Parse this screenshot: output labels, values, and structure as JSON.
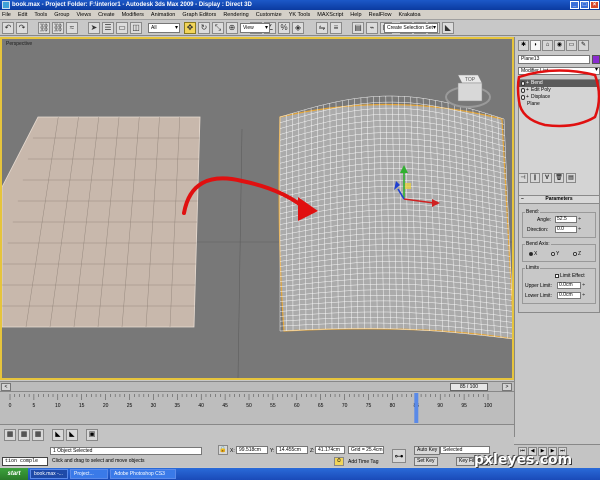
{
  "window": {
    "title": "book.max   - Project Folder: F:\\interior1   - Autodesk 3ds Max  2009   - Display : Direct 3D"
  },
  "menu": [
    "File",
    "Edit",
    "Tools",
    "Group",
    "Views",
    "Create",
    "Modifiers",
    "Animation",
    "Graph Editors",
    "Rendering",
    "Customize",
    "YK Tools",
    "MAXScript",
    "Help",
    "RealFlow",
    "Krakatoa"
  ],
  "toolbar": {
    "filter_value": "All",
    "refcoord_value": "View",
    "selection_set_placeholder": "Create Selection Set",
    "icons": [
      "undo-icon",
      "redo-icon",
      "link-icon",
      "unlink-icon",
      "bind-icon",
      "select-icon",
      "select-by-name-icon",
      "rect-select-icon",
      "window-crossing-icon",
      "move-icon",
      "rotate-icon",
      "scale-icon",
      "pivot-icon",
      "snap-icon",
      "angle-snap-icon",
      "percent-snap-icon",
      "spinner-snap-icon",
      "mirror-icon",
      "align-icon",
      "layers-icon",
      "curve-editor-icon",
      "schematic-icon",
      "material-editor-icon",
      "render-setup-icon",
      "render-icon",
      "quick-render-icon"
    ]
  },
  "viewport": {
    "label": "Perspective",
    "viewcube_label": "TOP",
    "border_color": "#e6c43c"
  },
  "command_panel": {
    "object_name": "Plane13",
    "object_color": "#8a2bd0",
    "modifier_list_label": "Modifier List",
    "stack": [
      {
        "name": "Bend",
        "selected": true
      },
      {
        "name": "Edit Poly",
        "selected": false
      },
      {
        "name": "Displace",
        "selected": false
      },
      {
        "name": "Plane",
        "selected": false
      }
    ],
    "parameters": {
      "rollout_title": "Parameters",
      "bend_group": "Bend:",
      "angle_label": "Angle:",
      "angle_value": "52.5",
      "direction_label": "Direction:",
      "direction_value": "0.0",
      "axis_group": "Bend Axis:",
      "axis_options": [
        "X",
        "Y",
        "Z"
      ],
      "axis_selected": "X",
      "limits_group": "Limits",
      "limit_effect_label": "Limit Effect",
      "upper_limit_label": "Upper Limit:",
      "upper_limit_value": "0.0cm",
      "lower_limit_label": "Lower Limit:",
      "lower_limit_value": "0.0cm"
    }
  },
  "timeline": {
    "slider_label": "85 / 100",
    "current_frame": 85,
    "total_frames": 100,
    "tick_labels": [
      "0",
      "5",
      "10",
      "15",
      "20",
      "25",
      "30",
      "35",
      "40",
      "45",
      "50",
      "55",
      "60",
      "65",
      "70",
      "75",
      "80",
      "85",
      "90",
      "95",
      "100"
    ]
  },
  "status": {
    "selection_count": "1 Object Selected",
    "prompt": "Click and drag to select and move objects",
    "x_label": "X:",
    "x_value": "99.518cm",
    "y_label": "Y:",
    "y_value": "14.455cm",
    "z_label": "Z:",
    "z_value": "41.174cm",
    "grid": "Grid = 25.4cm",
    "add_time_tag": "Add Time Tag",
    "auto_key": "Auto Key",
    "set_key": "Set Key",
    "selected_value": "Selected",
    "key_filters": "Key Filters...",
    "maxscript_text": "tion comple"
  },
  "taskbar": {
    "start": "start",
    "tasks": [
      "book.max -...",
      "Project...",
      "Adobe Photoshop CS3"
    ],
    "active_index": 0
  },
  "watermark": "pxleyes.com",
  "annotation_color": "#e01010"
}
